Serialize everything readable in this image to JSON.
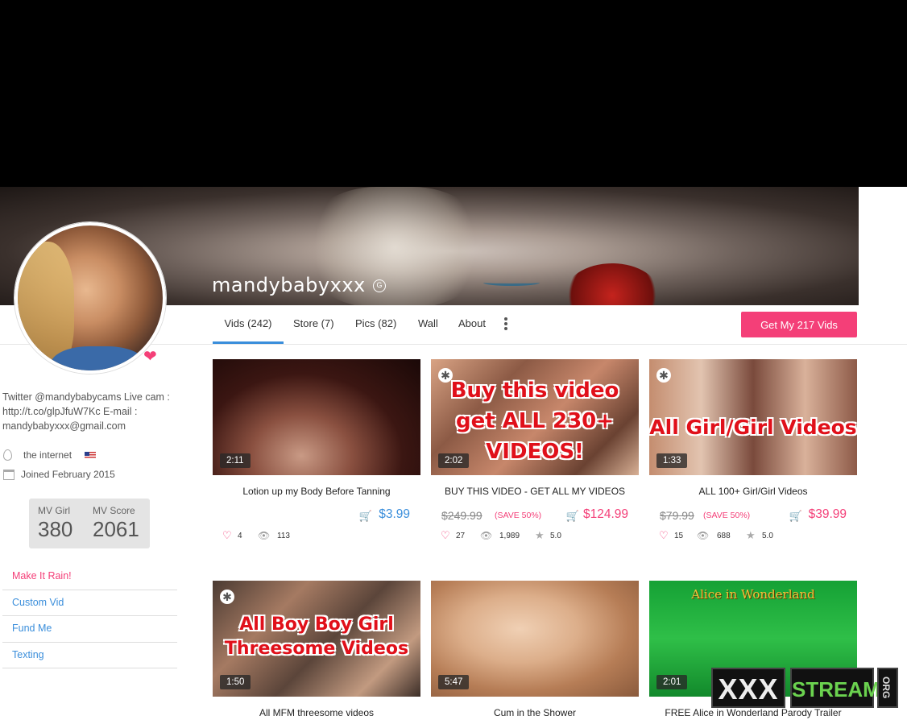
{
  "profile": {
    "username": "mandybabyxxx",
    "badge": "G",
    "bio": "Twitter @mandybabycams Live cam : http://t.co/glpJfuW7Kc E-mail : mandybabyxxx@gmail.com",
    "location": "the internet",
    "joined": "Joined February 2015",
    "mv_girl_label": "MV Girl",
    "mv_girl_value": "380",
    "mv_score_label": "MV Score",
    "mv_score_value": "2061"
  },
  "nav": {
    "tabs": [
      {
        "label": "Vids (242)"
      },
      {
        "label": "Store (7)"
      },
      {
        "label": "Pics (82)"
      },
      {
        "label": "Wall"
      },
      {
        "label": "About"
      }
    ],
    "cta": "Get My 217 Vids"
  },
  "side_menu": [
    {
      "label": "Make It Rain!"
    },
    {
      "label": "Custom Vid"
    },
    {
      "label": "Fund Me"
    },
    {
      "label": "Texting"
    }
  ],
  "videos": [
    {
      "title": "Lotion up my Body Before Tanning",
      "duration": "2:11",
      "price": "$3.99",
      "likes": "4",
      "views": "113"
    },
    {
      "title": "BUY THIS VIDEO - GET ALL MY VIDEOS",
      "duration": "2:02",
      "old_price": "$249.99",
      "save": "(SAVE 50%)",
      "price": "$124.99",
      "likes": "27",
      "views": "1,989",
      "rating": "5.0",
      "overlay": "Buy this video get ALL 230+ VIDEOS!"
    },
    {
      "title": "ALL 100+ Girl/Girl Videos",
      "duration": "1:33",
      "old_price": "$79.99",
      "save": "(SAVE 50%)",
      "price": "$39.99",
      "likes": "15",
      "views": "688",
      "rating": "5.0",
      "overlay": "All Girl/Girl Videos"
    },
    {
      "title": "All MFM threesome videos",
      "duration": "1:50",
      "overlay": "All Boy Boy Girl Threesome Videos"
    },
    {
      "title": "Cum in the Shower",
      "duration": "5:47"
    },
    {
      "title": "FREE Alice in Wonderland Parody Trailer",
      "duration": "2:01",
      "overlay": "Alice in Wonderland"
    }
  ],
  "watermark": {
    "part1": "XXX",
    "part2": "STREAMS",
    "part3": "ORG"
  },
  "colors": {
    "accent_pink": "#f43f78",
    "accent_blue": "#3a8edb"
  }
}
